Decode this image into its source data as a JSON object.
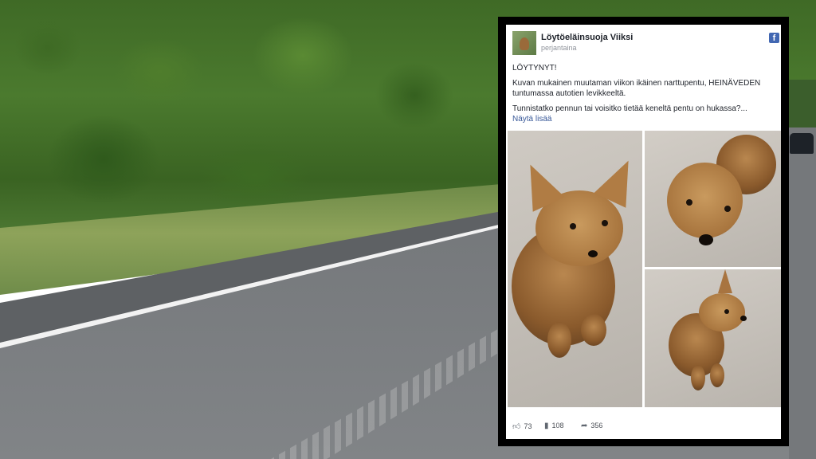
{
  "post": {
    "page_name": "Löytöeläinsuoja Viiksi",
    "time": "perjantaina",
    "icon": "facebook-icon",
    "paragraphs": [
      "LÖYTYNYT!",
      "Kuvan mukainen muutaman viikon ikäinen narttupentu, HEINÄVEDEN tuntumassa autotien levikkeeltä.",
      "Tunnistatko pennun tai voisitko tietää keneltä pentu on hukassa?..."
    ],
    "more_link": "Näytä lisää",
    "stats": {
      "likes": "73",
      "comments": "108",
      "shares": "356"
    }
  },
  "colors": {
    "facebook_blue": "#4267b2",
    "link_blue": "#385898"
  }
}
